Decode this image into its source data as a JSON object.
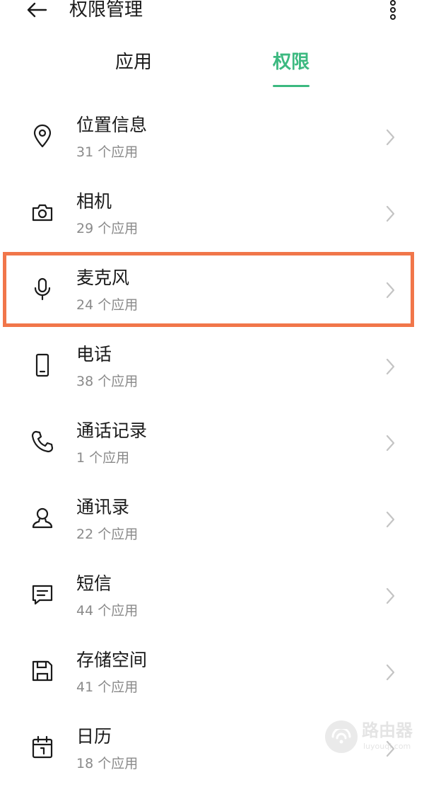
{
  "header": {
    "title": "权限管理",
    "back_icon": "arrow-left-icon",
    "more_icon": "more-vertical-icon"
  },
  "tabs": [
    {
      "label": "应用",
      "active": false
    },
    {
      "label": "权限",
      "active": true
    }
  ],
  "accent_color": "#3cb980",
  "highlight_color": "#f1764a",
  "permissions": [
    {
      "name": "位置信息",
      "count": "31 个应用",
      "icon": "location-icon"
    },
    {
      "name": "相机",
      "count": "29 个应用",
      "icon": "camera-icon"
    },
    {
      "name": "麦克风",
      "count": "24 个应用",
      "icon": "microphone-icon",
      "highlighted": true
    },
    {
      "name": "电话",
      "count": "38 个应用",
      "icon": "phone-device-icon"
    },
    {
      "name": "通话记录",
      "count": "1 个应用",
      "icon": "call-handset-icon"
    },
    {
      "name": "通讯录",
      "count": "22 个应用",
      "icon": "contact-person-icon"
    },
    {
      "name": "短信",
      "count": "44 个应用",
      "icon": "message-icon"
    },
    {
      "name": "存储空间",
      "count": "41 个应用",
      "icon": "storage-icon"
    },
    {
      "name": "日历",
      "count": "18 个应用",
      "icon": "calendar-icon"
    }
  ],
  "watermark": {
    "text": "路由器",
    "url": "luyouqi.com"
  }
}
